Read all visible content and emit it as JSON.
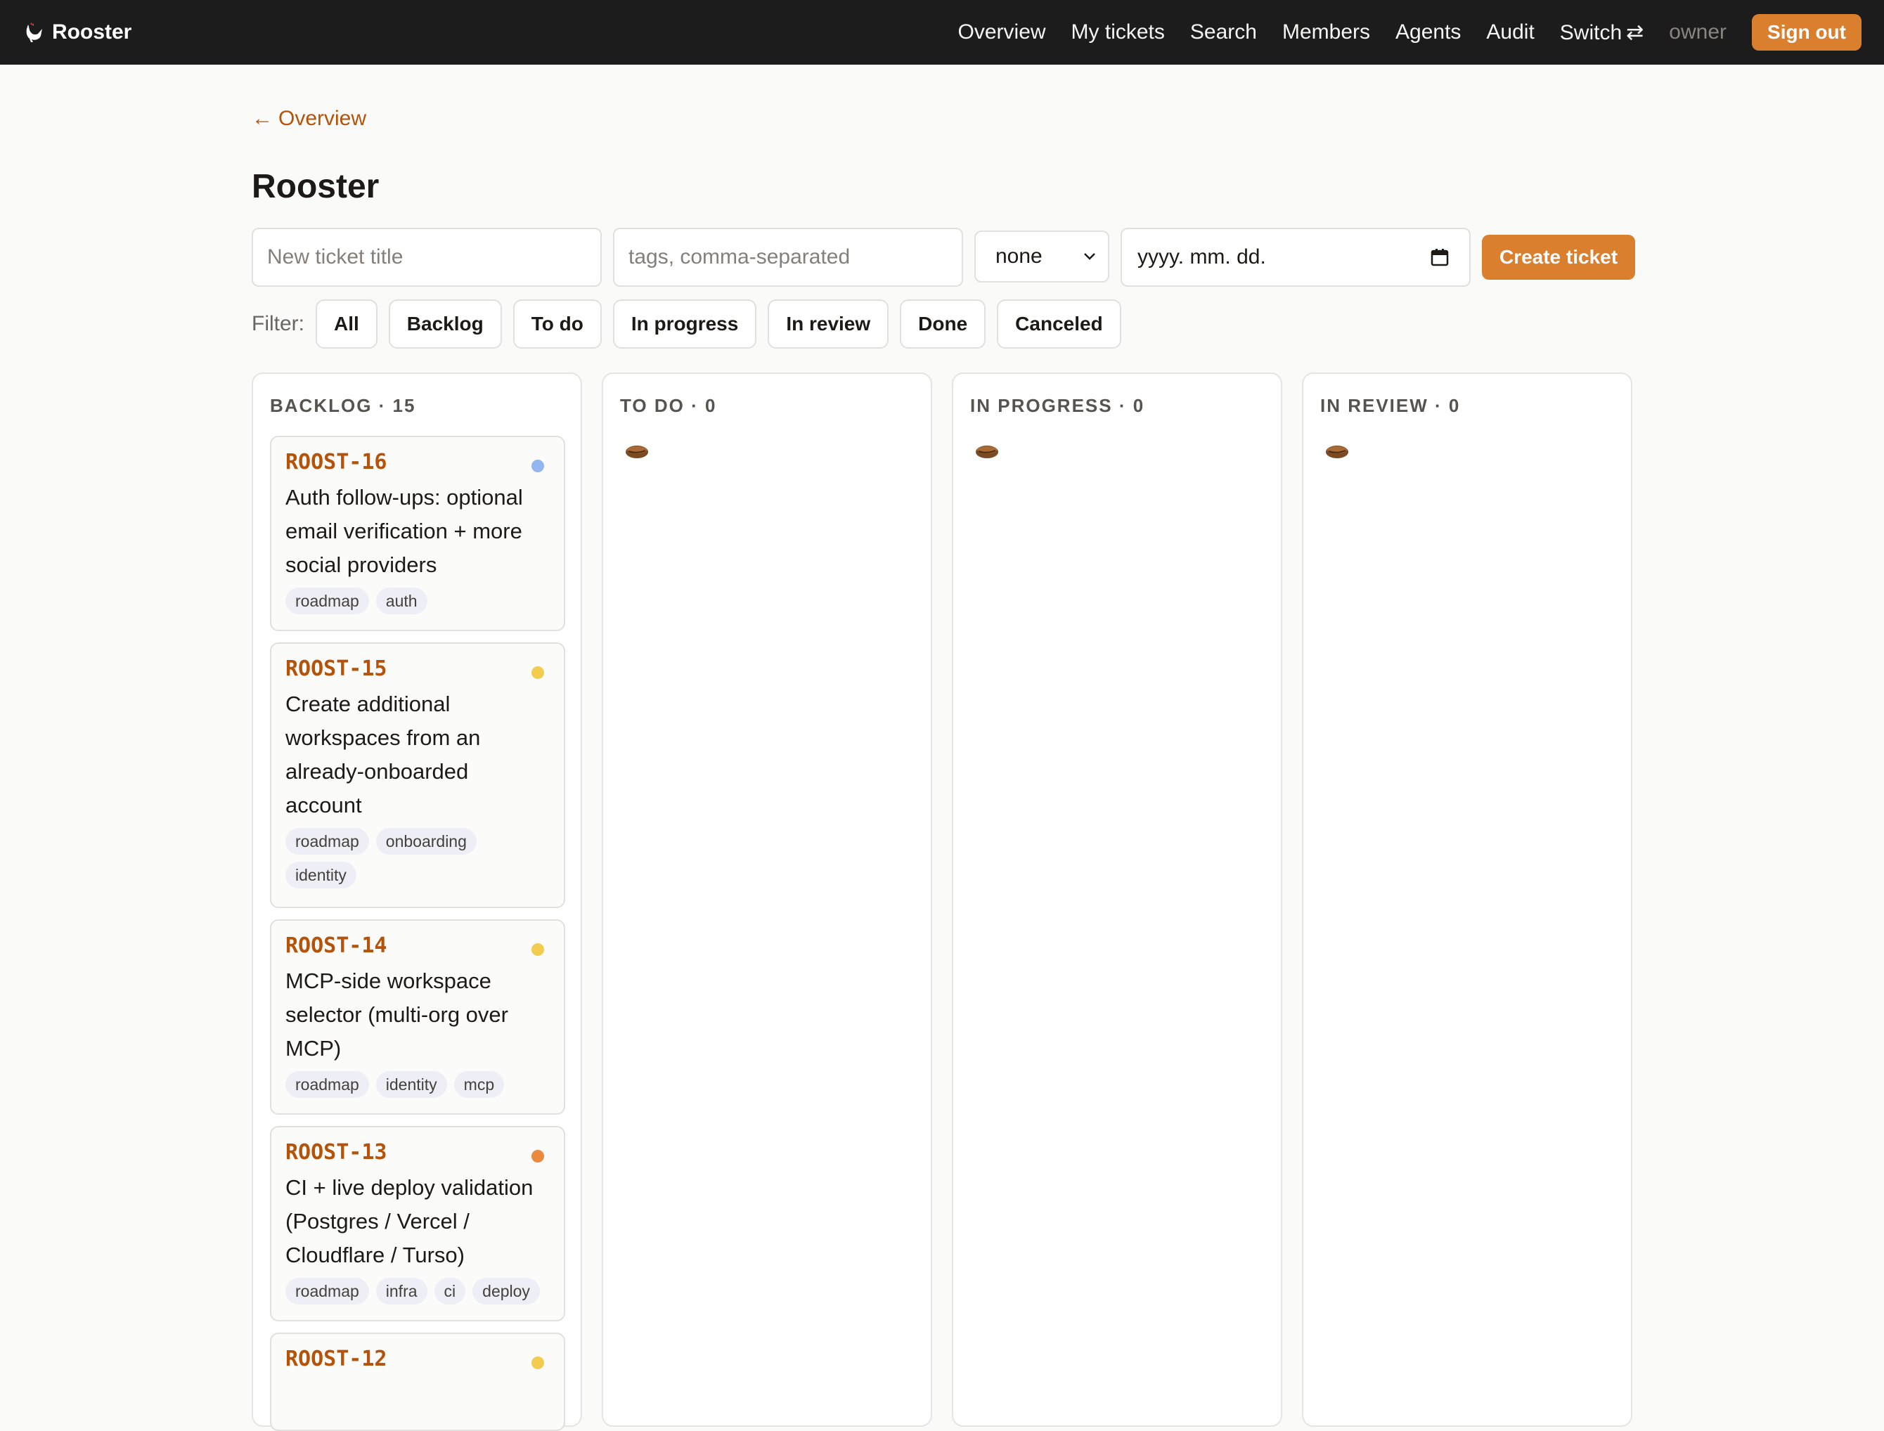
{
  "brand": {
    "name": "Rooster",
    "logo_icon": "rooster-icon"
  },
  "nav": {
    "links": [
      "Overview",
      "My tickets",
      "Search",
      "Members",
      "Agents",
      "Audit"
    ],
    "switch_label": "Switch",
    "switch_icon": "⇄",
    "role": "owner",
    "signout_label": "Sign out"
  },
  "back": {
    "arrow": "←",
    "label": "Overview"
  },
  "page_title": "Rooster",
  "form": {
    "title_placeholder": "New ticket title",
    "tags_placeholder": "tags, comma-separated",
    "priority_value": "none",
    "date_placeholder": "yyyy. mm. dd.",
    "create_label": "Create ticket"
  },
  "filter": {
    "label": "Filter:",
    "options": [
      "All",
      "Backlog",
      "To do",
      "In progress",
      "In review",
      "Done",
      "Canceled"
    ]
  },
  "columns": [
    {
      "header": "BACKLOG · 15",
      "cards": [
        {
          "id": "ROOST-16",
          "title": "Auth follow-ups: optional email verification + more social providers",
          "tags": [
            "roadmap",
            "auth"
          ],
          "priority_color": "#93b5f0"
        },
        {
          "id": "ROOST-15",
          "title": "Create additional workspaces from an already-onboarded account",
          "tags": [
            "roadmap",
            "onboarding",
            "identity"
          ],
          "priority_color": "#f2cc4e"
        },
        {
          "id": "ROOST-14",
          "title": "MCP-side workspace selector (multi-org over MCP)",
          "tags": [
            "roadmap",
            "identity",
            "mcp"
          ],
          "priority_color": "#f2cc4e"
        },
        {
          "id": "ROOST-13",
          "title": "CI + live deploy validation (Postgres / Vercel / Cloudflare / Turso)",
          "tags": [
            "roadmap",
            "infra",
            "ci",
            "deploy"
          ],
          "priority_color": "#ea8a3f"
        },
        {
          "id": "ROOST-12",
          "title": "",
          "tags": [],
          "priority_color": "#f2cc4e"
        }
      ]
    },
    {
      "header": "TO DO · 0",
      "empty_icon": "coffee-bean-icon"
    },
    {
      "header": "IN PROGRESS · 0",
      "empty_icon": "coffee-bean-icon"
    },
    {
      "header": "IN REVIEW · 0",
      "empty_icon": "coffee-bean-icon"
    }
  ]
}
